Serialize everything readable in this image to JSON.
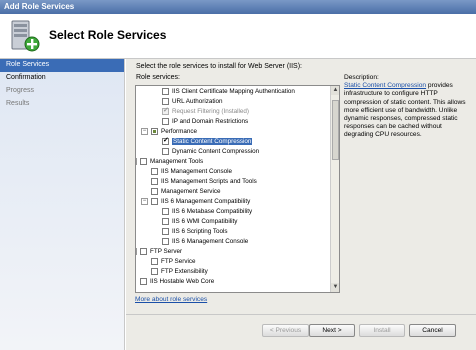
{
  "window": {
    "title": "Add Role Services"
  },
  "header": {
    "title": "Select Role Services"
  },
  "nav": [
    {
      "label": "Role Services",
      "state": "active"
    },
    {
      "label": "Confirmation",
      "state": "normal"
    },
    {
      "label": "Progress",
      "state": "disabled"
    },
    {
      "label": "Results",
      "state": "disabled"
    }
  ],
  "main": {
    "instruction": "Select the role services to install for Web Server (IIS):",
    "services_label": "Role services:",
    "description_label": "Description:",
    "description_link": "Static Content Compression",
    "description_text": " provides infrastructure to configure HTTP compression of static content. This allows more efficient use of bandwidth. Unlike dynamic responses, compressed static responses can be cached without degrading CPU resources.",
    "more_link": "More about role services"
  },
  "tree": [
    {
      "label": "IIS Client Certificate Mapping Authentication",
      "level": 3,
      "checked": false,
      "grey": false
    },
    {
      "label": "URL Authorization",
      "level": 3,
      "checked": false,
      "grey": false
    },
    {
      "label": "Request Filtering  (Installed)",
      "level": 3,
      "checked": true,
      "grey": true
    },
    {
      "label": "IP and Domain Restrictions",
      "level": 3,
      "checked": false,
      "grey": false
    },
    {
      "label": "Performance",
      "level": 2,
      "checked": false,
      "grey": false,
      "expander": "−",
      "partial": true
    },
    {
      "label": "Static Content Compression",
      "level": 3,
      "checked": true,
      "grey": false,
      "selected": true
    },
    {
      "label": "Dynamic Content Compression",
      "level": 3,
      "checked": false,
      "grey": false
    },
    {
      "label": "Management Tools",
      "level": 1,
      "checked": false,
      "grey": false,
      "expander": "−"
    },
    {
      "label": "IIS Management Console",
      "level": 2,
      "checked": false,
      "grey": false
    },
    {
      "label": "IIS Management Scripts and Tools",
      "level": 2,
      "checked": false,
      "grey": false
    },
    {
      "label": "Management Service",
      "level": 2,
      "checked": false,
      "grey": false
    },
    {
      "label": "IIS 6 Management Compatibility",
      "level": 2,
      "checked": false,
      "grey": false,
      "expander": "−"
    },
    {
      "label": "IIS 6 Metabase Compatibility",
      "level": 3,
      "checked": false,
      "grey": false
    },
    {
      "label": "IIS 6 WMI Compatibility",
      "level": 3,
      "checked": false,
      "grey": false
    },
    {
      "label": "IIS 6 Scripting Tools",
      "level": 3,
      "checked": false,
      "grey": false
    },
    {
      "label": "IIS 6 Management Console",
      "level": 3,
      "checked": false,
      "grey": false
    },
    {
      "label": "FTP Server",
      "level": 1,
      "checked": false,
      "grey": false,
      "expander": "−"
    },
    {
      "label": "FTP Service",
      "level": 2,
      "checked": false,
      "grey": false
    },
    {
      "label": "FTP Extensibility",
      "level": 2,
      "checked": false,
      "grey": false
    },
    {
      "label": "IIS Hostable Web Core",
      "level": 1,
      "checked": false,
      "grey": false
    }
  ],
  "buttons": {
    "previous": "< Previous",
    "next": "Next >",
    "install": "Install",
    "cancel": "Cancel"
  },
  "colors": {
    "accent": "#3a6cb6",
    "link": "#1a4fa8"
  },
  "icons": {
    "header": "server-add-icon"
  }
}
